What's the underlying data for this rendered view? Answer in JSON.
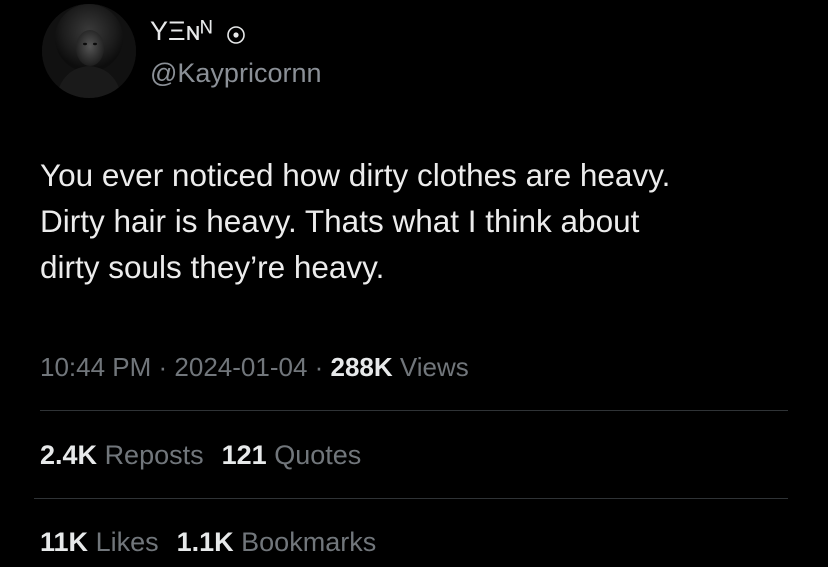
{
  "author": {
    "display_name": "Y̲Ɇᴺᴺ",
    "display_name_text": "ΥΞɴᴺ",
    "name_icon": "sun-circle-icon",
    "handle": "@Kaypricornn",
    "avatar": "profile-avatar"
  },
  "tweet": {
    "lines": [
      "You ever noticed how dirty clothes are heavy.",
      "Dirty hair is heavy. Thats what I think about",
      "dirty souls they’re heavy."
    ]
  },
  "meta": {
    "time": "10:44 PM",
    "separator": " · ",
    "date": "2024-01-04",
    "views_count": "288K",
    "views_label": "Views"
  },
  "stats": {
    "reposts_count": "2.4K",
    "reposts_label": "Reposts",
    "quotes_count": "121",
    "quotes_label": "Quotes",
    "likes_count": "11K",
    "likes_label": "Likes",
    "bookmarks_count": "1.1K",
    "bookmarks_label": "Bookmarks"
  },
  "colors": {
    "background": "#000000",
    "primary_text": "#e7e9ea",
    "secondary_text": "#71767b",
    "divider": "#2f3336"
  }
}
